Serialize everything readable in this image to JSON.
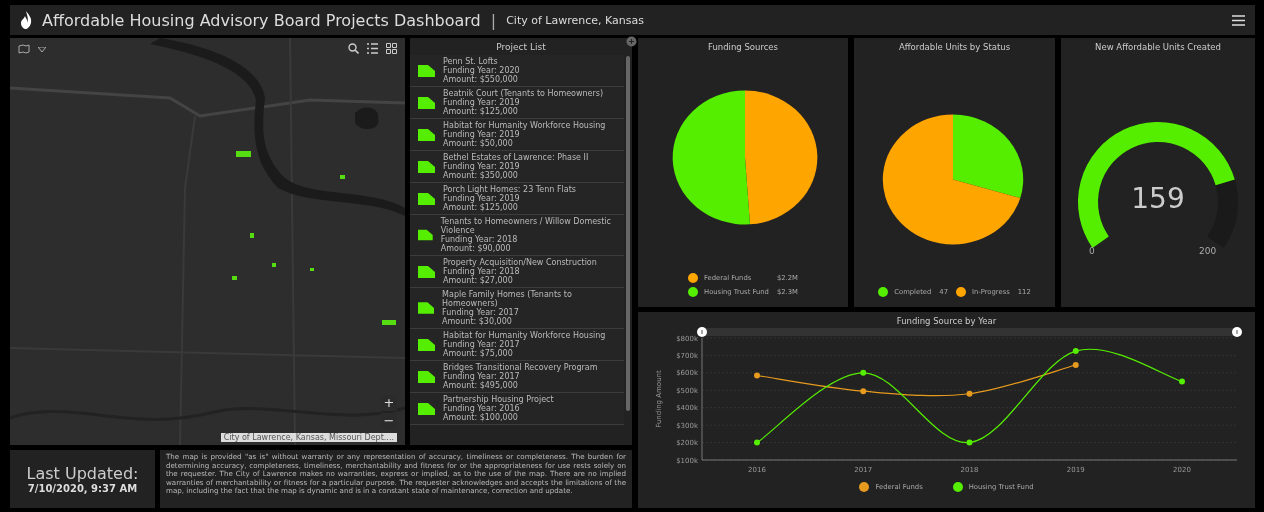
{
  "header": {
    "title": "Affordable Housing Advisory Board Projects Dashboard",
    "separator": "|",
    "subtitle": "City of Lawrence, Kansas"
  },
  "map": {
    "kind": "picture",
    "attribution": "City of Lawrence, Kansas, Missouri Dept....",
    "zoom_in": "+",
    "zoom_out": "−"
  },
  "project_list": {
    "title": "Project List",
    "items": [
      {
        "name": "Penn St. Lofts",
        "year": "Funding Year: 2020",
        "amount": "Amount: $550,000"
      },
      {
        "name": "Beatnik Court (Tenants to Homeowners)",
        "year": "Funding Year: 2019",
        "amount": "Amount: $125,000"
      },
      {
        "name": "Habitat for Humanity Workforce Housing",
        "year": "Funding Year: 2019",
        "amount": "Amount: $50,000"
      },
      {
        "name": "Bethel Estates of Lawrence: Phase II",
        "year": "Funding Year: 2019",
        "amount": "Amount: $350,000"
      },
      {
        "name": "Porch Light Homes: 23 Tenn Flats",
        "year": "Funding Year: 2019",
        "amount": "Amount: $125,000"
      },
      {
        "name": "Tenants to Homeowners / Willow Domestic Violence",
        "year": "Funding Year: 2018",
        "amount": "Amount: $90,000"
      },
      {
        "name": "Property Acquisition/New Construction",
        "year": "Funding Year: 2018",
        "amount": "Amount: $27,000"
      },
      {
        "name": "Maple Family Homes (Tenants to Homeowners)",
        "year": "Funding Year: 2017",
        "amount": "Amount: $30,000"
      },
      {
        "name": "Habitat for Humanity Workforce Housing",
        "year": "Funding Year: 2017",
        "amount": "Amount: $75,000"
      },
      {
        "name": "Bridges Transitional Recovery Program",
        "year": "Funding Year: 2017",
        "amount": "Amount: $495,000"
      },
      {
        "name": "Partnership Housing Project",
        "year": "Funding Year: 2016",
        "amount": "Amount: $100,000"
      }
    ]
  },
  "last_updated": {
    "label": "Last Updated:",
    "value": "7/10/2020, 9:37 AM"
  },
  "disclaimer": "The map is provided \"as is\" without warranty or any representation of accuracy, timeliness or completeness.  The burden for determining accuracy, completeness, timeliness, merchantability and fitness for or the appropriateness for use rests solely on the requester.  The City of Lawrence makes no warranties, express or implied, as to the use of the map.  There are no implied warranties of merchantability or fitness for a particular purpose.  The requester acknowledges and accepts the limitations of the map, including the fact that the map is dynamic and is in a constant state of maintenance, correction and update.",
  "funding_sources": {
    "title": "Funding Sources",
    "legend": [
      {
        "value": "$2.2M",
        "color": "#ffa500"
      },
      {
        "value": "$2.3M",
        "color": "#55ee00"
      }
    ],
    "chart_data": {
      "type": "pie",
      "categories": [
        "Federal Funds",
        "Housing Trust Fund"
      ],
      "values": [
        48.9,
        51.1
      ]
    }
  },
  "units_by_status": {
    "title": "Affordable Units by Status",
    "legend": [
      {
        "value": "47",
        "color": "#55ee00"
      },
      {
        "value": "112",
        "color": "#ffa500"
      }
    ],
    "chart_data": {
      "type": "pie",
      "categories": [
        "Completed",
        "In-Progress"
      ],
      "values": [
        29.6,
        70.4
      ]
    }
  },
  "gauge": {
    "title": "New Affordable Units Created",
    "value": "159",
    "min": "0",
    "max": "200"
  },
  "funding_by_year": {
    "title": "Funding Source by Year",
    "chart_data": {
      "type": "line",
      "grid": true,
      "ylabel": "Funding Amount",
      "categories": [
        "2016",
        "2017",
        "2018",
        "2019",
        "2020"
      ],
      "series": [
        {
          "name": "Federal Funds",
          "color": "#e69a1e",
          "marker": true,
          "values": [
            585000,
            495000,
            480000,
            645000,
            null
          ]
        },
        {
          "name": "Housing Trust Fund",
          "color": "#55ee00",
          "marker": true,
          "values": [
            200000,
            600000,
            200000,
            725000,
            550000
          ]
        }
      ],
      "ylim": [
        100000,
        800000
      ],
      "yticks": [
        {
          "value": 100000,
          "label": "$100k"
        },
        {
          "value": 200000,
          "label": "$200k"
        },
        {
          "value": 300000,
          "label": "$300k"
        },
        {
          "value": 400000,
          "label": "$400k"
        },
        {
          "value": 500000,
          "label": "$500k"
        },
        {
          "value": 600000,
          "label": "$600k"
        },
        {
          "value": 700000,
          "label": "$700k"
        },
        {
          "value": 800000,
          "label": "$800k"
        }
      ]
    }
  }
}
